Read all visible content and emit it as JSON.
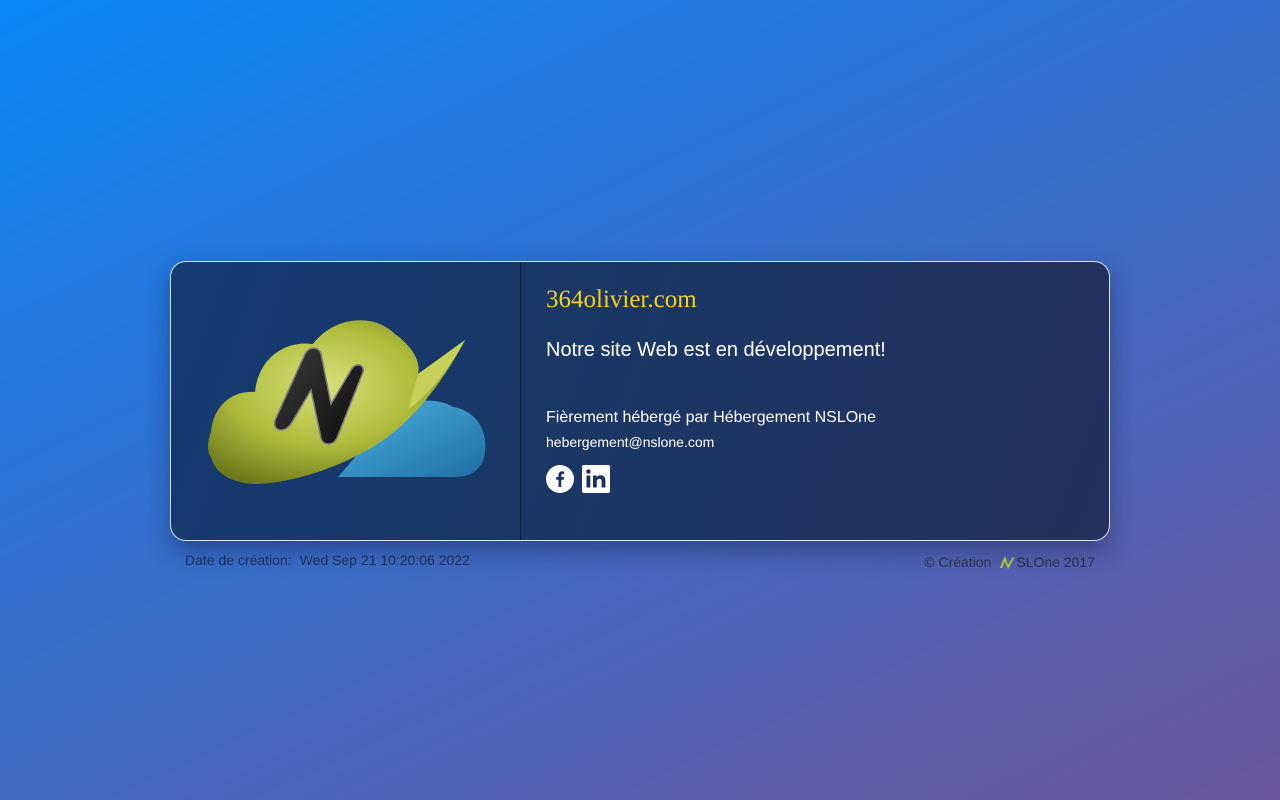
{
  "card": {
    "site_name": "364olivier.com",
    "tagline": "Notre site Web est en développement!",
    "hosted_by": "Fièrement hébergé par Hébergement NSLOne",
    "email": "hebergement@nslone.com",
    "social": [
      {
        "icon": "facebook-icon"
      },
      {
        "icon": "linkedin-icon"
      }
    ]
  },
  "footer": {
    "date_label": "Date de création:",
    "date_value": "Wed Sep 21 10:20:06 2022",
    "copyright_prefix": "© Création",
    "copyright_brand": "SLOne 2017"
  },
  "colors": {
    "title": "#f2d21b",
    "logo_olive": "#a9b83a",
    "logo_blue": "#2f8fc9",
    "card_bg": "#1a3766"
  }
}
